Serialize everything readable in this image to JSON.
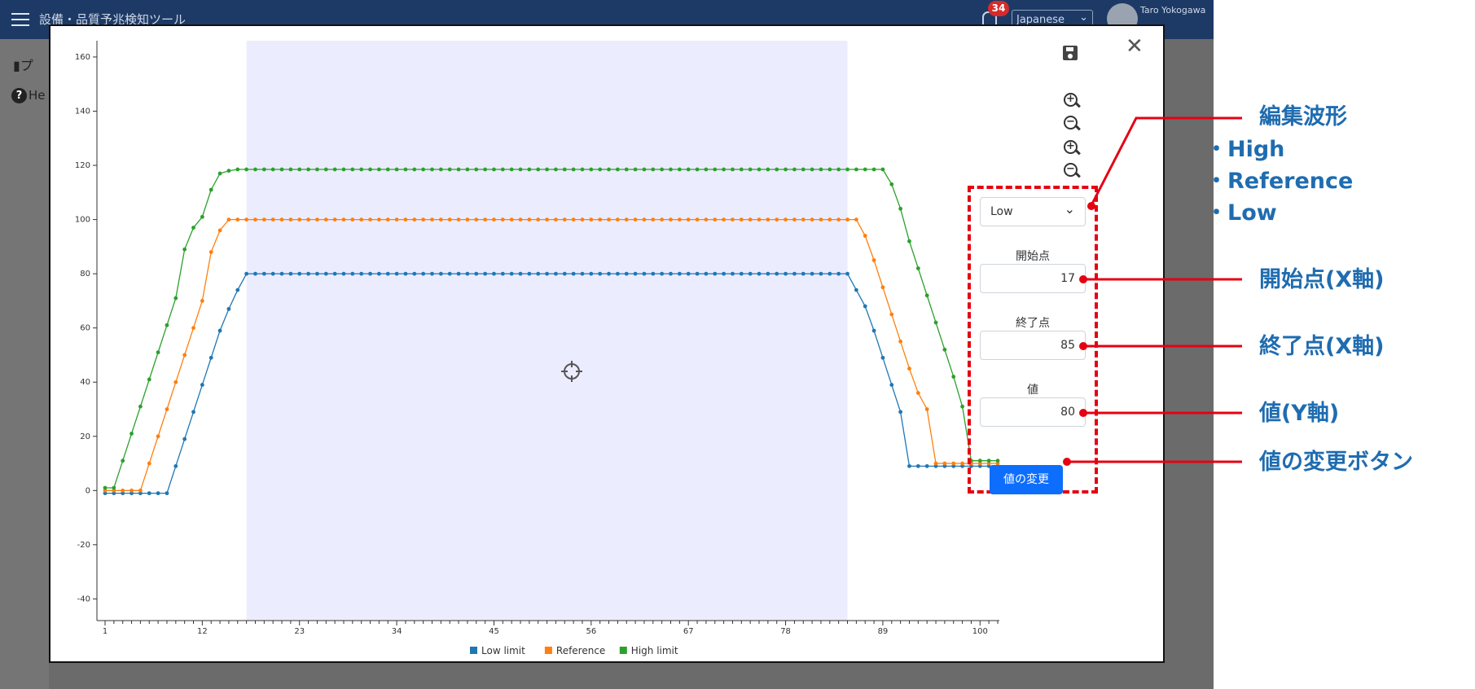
{
  "app": {
    "title": "設備・品質予兆検知ツール",
    "notification_count": "34",
    "language": "Japanese",
    "user_name": "Taro Yokogawa",
    "page_title_partial": "プ",
    "help_label_partial": "He"
  },
  "edit_panel": {
    "waveform_select_value": "Low",
    "start_label": "開始点",
    "start_value": "17",
    "end_label": "終了点",
    "end_value": "85",
    "value_label": "値",
    "value_value": "80",
    "apply_button_label": "値の変更"
  },
  "toolbar": {
    "icons": [
      "save-icon",
      "close-icon",
      "zoom-in-x-icon",
      "zoom-out-x-icon",
      "zoom-in-y-icon",
      "zoom-out-y-icon",
      "crosshair-icon"
    ]
  },
  "callouts": {
    "waveform_title": "編集波形",
    "waveform_high": "・High",
    "waveform_reference": "・Reference",
    "waveform_low": "・Low",
    "start": "開始点(X軸)",
    "end": "終了点(X軸)",
    "value": "値(Y軸)",
    "apply": "値の変更ボタン",
    "color": "#1f6cb0",
    "line_color": "#e50012"
  },
  "chart_data": {
    "type": "line",
    "x": [
      1,
      101
    ],
    "xticks": [
      "1",
      "12",
      "23",
      "34",
      "45",
      "56",
      "67",
      "78",
      "89",
      "100"
    ],
    "yticks": [
      "160",
      "140",
      "120",
      "100",
      "80",
      "60",
      "40",
      "20",
      "0",
      "-20",
      "-40"
    ],
    "ylim": [
      -48,
      166
    ],
    "xlim": [
      1,
      102
    ],
    "highlight_range": [
      17,
      85
    ],
    "highlight_color": "#ececff",
    "legend": [
      "Low limit",
      "Reference",
      "High limit"
    ],
    "series": [
      {
        "name": "Low limit",
        "color": "#1f77b4",
        "points": [
          [
            1,
            -1
          ],
          [
            8,
            -1
          ],
          [
            9,
            9
          ],
          [
            10,
            19
          ],
          [
            11,
            29
          ],
          [
            12,
            39
          ],
          [
            13,
            49
          ],
          [
            14,
            59
          ],
          [
            15,
            67
          ],
          [
            16,
            74
          ],
          [
            17,
            80
          ],
          [
            85,
            80
          ],
          [
            86,
            74
          ],
          [
            87,
            68
          ],
          [
            88,
            59
          ],
          [
            89,
            49
          ],
          [
            90,
            39
          ],
          [
            91,
            29
          ],
          [
            92,
            9
          ],
          [
            102,
            9
          ]
        ]
      },
      {
        "name": "Reference",
        "color": "#ff7f0e",
        "points": [
          [
            1,
            0
          ],
          [
            5,
            0
          ],
          [
            6,
            10
          ],
          [
            7,
            20
          ],
          [
            8,
            30
          ],
          [
            9,
            40
          ],
          [
            10,
            50
          ],
          [
            11,
            60
          ],
          [
            12,
            70
          ],
          [
            13,
            88
          ],
          [
            14,
            96
          ],
          [
            15,
            100
          ],
          [
            86,
            100
          ],
          [
            87,
            94
          ],
          [
            88,
            85
          ],
          [
            89,
            75
          ],
          [
            90,
            65
          ],
          [
            91,
            55
          ],
          [
            92,
            45
          ],
          [
            93,
            36
          ],
          [
            94,
            30
          ],
          [
            95,
            10
          ],
          [
            102,
            10
          ]
        ]
      },
      {
        "name": "High limit",
        "color": "#2ca02c",
        "points": [
          [
            1,
            1
          ],
          [
            2,
            1
          ],
          [
            3,
            11
          ],
          [
            4,
            21
          ],
          [
            5,
            31
          ],
          [
            6,
            41
          ],
          [
            7,
            51
          ],
          [
            8,
            61
          ],
          [
            9,
            71
          ],
          [
            10,
            89
          ],
          [
            11,
            97
          ],
          [
            12,
            101
          ],
          [
            13,
            111
          ],
          [
            14,
            117
          ],
          [
            15,
            118
          ],
          [
            16,
            118.5
          ],
          [
            89,
            118.5
          ],
          [
            90,
            113
          ],
          [
            91,
            104
          ],
          [
            92,
            92
          ],
          [
            93,
            82
          ],
          [
            94,
            72
          ],
          [
            95,
            62
          ],
          [
            96,
            52
          ],
          [
            97,
            42
          ],
          [
            98,
            31
          ],
          [
            99,
            11
          ],
          [
            102,
            11
          ]
        ]
      }
    ]
  }
}
